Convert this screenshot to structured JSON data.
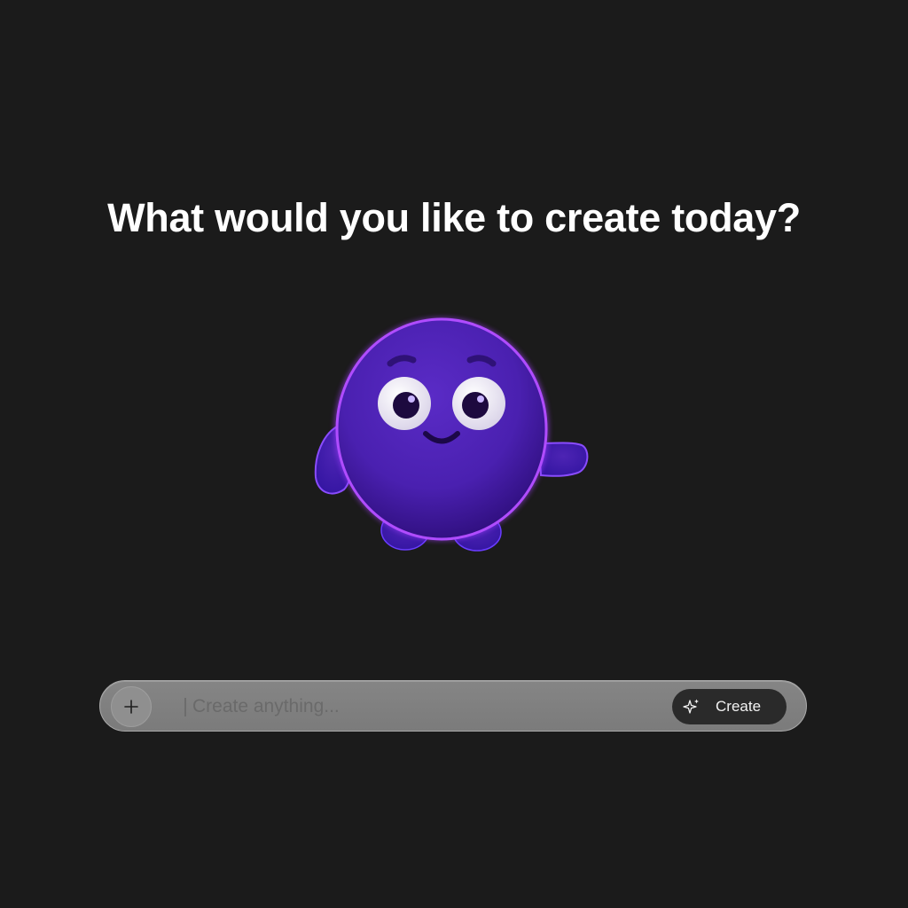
{
  "headline": "What would you like to create today?",
  "mascot": {
    "icon": "purple-blob-mascot-icon",
    "colors": {
      "body": "#4a20b5",
      "rim": "#a638ff",
      "eye_white": "#f1eef8",
      "pupil": "#1d0a3f"
    }
  },
  "prompt_bar": {
    "add_icon": "plus-icon",
    "placeholder": "Create anything...",
    "value": "",
    "create_button": {
      "label": "Create",
      "icon": "sparkle-icon"
    }
  },
  "colors": {
    "background": "#1b1b1b",
    "prompt_bar": "#808080",
    "button": "#2a2a2a"
  }
}
